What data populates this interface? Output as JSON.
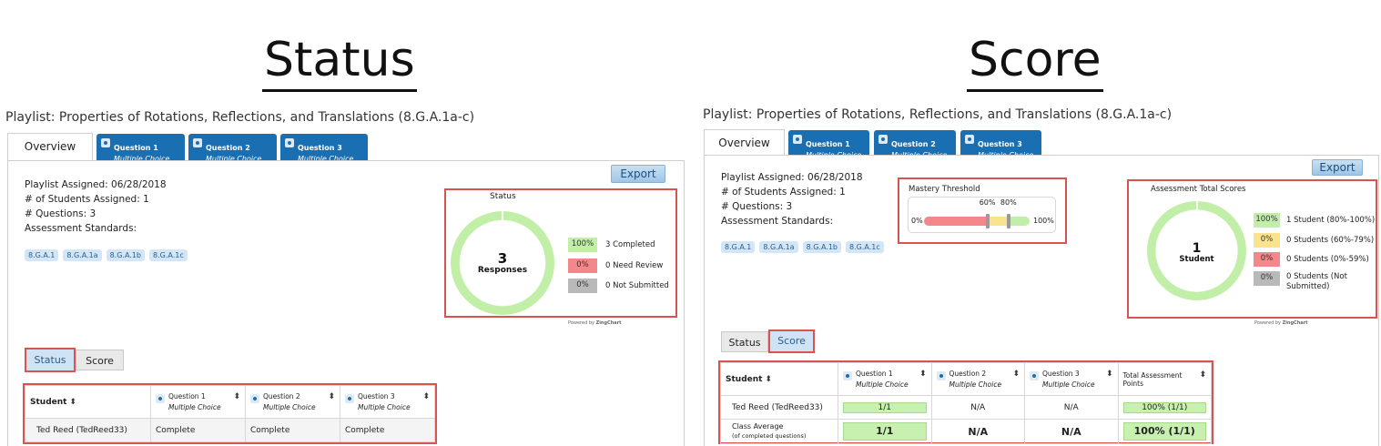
{
  "headings": {
    "left": "Status",
    "right": "Score"
  },
  "playlist_title": "Playlist: Properties of Rotations, Reflections, and Translations (8.G.A.1a-c)",
  "tabs": {
    "overview": "Overview",
    "questions": [
      {
        "title": "Question 1",
        "type": "Multiple Choice"
      },
      {
        "title": "Question 2",
        "type": "Multiple Choice"
      },
      {
        "title": "Question 3",
        "type": "Multiple Choice"
      }
    ]
  },
  "export_label": "Export",
  "info": {
    "assigned": "Playlist Assigned: 06/28/2018",
    "students": "# of Students Assigned: 1",
    "questions": "# Questions: 3",
    "standards_label": "Assessment Standards:",
    "standards": [
      "8.G.A.1",
      "8.G.A.1a",
      "8.G.A.1b",
      "8.G.A.1c"
    ]
  },
  "status_chart": {
    "title": "Status",
    "center_number": "3",
    "center_label": "Responses",
    "legend": [
      {
        "chip": "100%",
        "text": "3 Completed",
        "color": "#c2efa8"
      },
      {
        "chip": "0%",
        "text": "0 Need Review",
        "color": "#f4878a"
      },
      {
        "chip": "0%",
        "text": "0 Not Submitted",
        "color": "#b9b9b9"
      }
    ]
  },
  "score_chart": {
    "title": "Assessment Total Scores",
    "center_number": "1",
    "center_label": "Student",
    "legend": [
      {
        "chip": "100%",
        "text": "1 Student (80%-100%)",
        "color": "#c2efa8"
      },
      {
        "chip": "0%",
        "text": "0 Students (60%-79%)",
        "color": "#fbe28c"
      },
      {
        "chip": "0%",
        "text": "0 Students (0%-59%)",
        "color": "#f4878a"
      },
      {
        "chip": "0%",
        "text": "0 Students (Not Submitted)",
        "color": "#b9b9b9"
      }
    ]
  },
  "mastery": {
    "title": "Mastery Threshold",
    "min_label": "0%",
    "max_label": "100%",
    "mark1_label": "60%",
    "mark2_label": "80%",
    "mark1_value": 60,
    "mark2_value": 80
  },
  "powered_by": "Powered by",
  "powered_brand": "ZingChart",
  "view_toggle": {
    "status": "Status",
    "score": "Score"
  },
  "status_table": {
    "student_header": "Student",
    "rows": [
      {
        "student": "Ted Reed (TedReed33)",
        "q1": "Complete",
        "q2": "Complete",
        "q3": "Complete"
      }
    ]
  },
  "score_table": {
    "student_header": "Student",
    "total_header": "Total Assessment Points",
    "rows": [
      {
        "student": "Ted Reed (TedReed33)",
        "q1": "1/1",
        "q2": "N/A",
        "q3": "N/A",
        "total": "100% (1/1)"
      }
    ],
    "average": {
      "label": "Class Average",
      "sublabel": "(of completed questions)",
      "q1": "1/1",
      "q2": "N/A",
      "q3": "N/A",
      "total": "100% (1/1)"
    }
  },
  "sort_glyph": "⬍"
}
